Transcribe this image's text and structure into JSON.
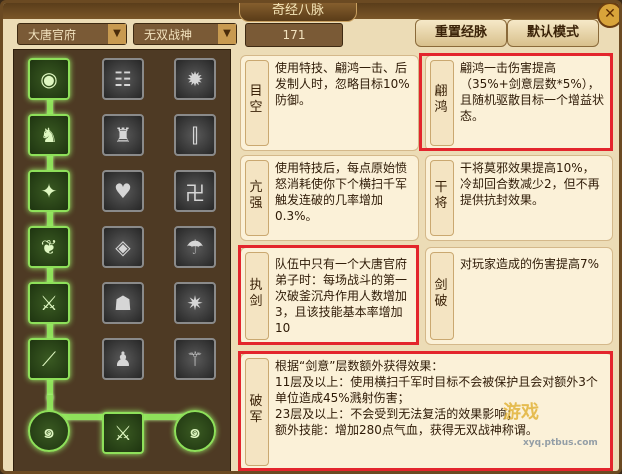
{
  "title": "奇经八脉",
  "selects": {
    "school": "大唐官府",
    "faction": "无双战神",
    "count": "171"
  },
  "buttons": {
    "reset": "重置经脉",
    "default": "默认模式"
  },
  "cards": {
    "mukong": {
      "name": "目空",
      "desc": "使用特技、翩鸿一击、后发制人时，忽略目标10%防御。"
    },
    "kangqiang": {
      "name": "亢强",
      "desc": "使用特技后，每点原始愤怒消耗使你下个横扫千军触发连破的几率增加0.3%。"
    },
    "zhijian": {
      "name": "执剑",
      "desc": "队伍中只有一个大唐官府弟子时：每场战斗的第一次破釜沉舟作用人数增加3，且该技能基本率增加10"
    },
    "pianhong": {
      "name": "翩鸿",
      "desc": "翩鸿一击伤害提高（35%+剑意层数*5%），且随机驱散目标一个增益状态。"
    },
    "ganjiang": {
      "name": "干将",
      "desc": "干将莫邪效果提高10%，冷却回合数减少2，但不再提供抗封效果。"
    },
    "jianpo": {
      "name": "剑破",
      "desc": "对玩家造成的伤害提高7%"
    },
    "pojun": {
      "name": "破军",
      "lines": [
        "根据“剑意”层数额外获得效果：",
        "11层及以上：使用横扫千军时目标不会被保护且会对额外3个单位造成45%溅射伤害；",
        "23层及以上：不会受到无法复活的效果影响；",
        "额外技能：增加280点气血，获得无双战神称谓。"
      ]
    }
  },
  "nodes": {
    "left": [
      "eye-icon",
      "rider-icon",
      "warrior-icon",
      "heart-icon",
      "sword-icon",
      "slash-icon"
    ],
    "mid": [
      "scroll-icon",
      "shadow-icon",
      "hearts-icon",
      "brave-icon",
      "figure-icon",
      "monk-icon"
    ],
    "right": [
      "demon-icon",
      "blades-icon",
      "seal-icon",
      "storm-icon",
      "break-icon",
      "spear-icon"
    ],
    "bottom": [
      "swirl-icon",
      "triple-sword-icon",
      "swirl-icon"
    ]
  },
  "watermark": {
    "main": "游戏",
    "sub": "xyq.ptbus.com"
  }
}
